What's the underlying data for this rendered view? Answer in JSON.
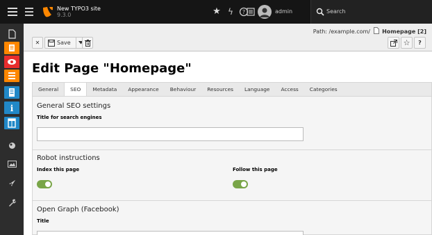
{
  "topbar": {
    "site_name": "New TYPO3 site",
    "version": "9.3.0",
    "username": "admin",
    "search_label": "Search",
    "icons": [
      "menu-icon",
      "module-list-icon",
      "typo3-logo-icon",
      "bookmark-star-icon",
      "flash-icon",
      "help-icon",
      "system-info-icon",
      "user-avatar-icon",
      "search-icon"
    ]
  },
  "sidebar": {
    "items": [
      {
        "name": "page-module-icon",
        "color": "#ff8700"
      },
      {
        "name": "view-module-icon",
        "color": "#e82d2d"
      },
      {
        "name": "list-module-icon",
        "color": "#ff8700"
      },
      {
        "name": "form-module-icon",
        "color": "#2188c7"
      },
      {
        "name": "info-module-icon",
        "color": "#2188c7"
      },
      {
        "name": "template-module-icon",
        "color": "#2188c7"
      },
      {
        "name": "globe-module-icon",
        "color": "#2d2d2d"
      },
      {
        "name": "filelist-module-icon",
        "color": "#2d2d2d"
      },
      {
        "name": "rocket-module-icon",
        "color": "#2d2d2d"
      },
      {
        "name": "tools-module-icon",
        "color": "#2d2d2d"
      }
    ]
  },
  "docheader": {
    "close_label": "✕",
    "save_label": "Save",
    "path_prefix": "Path: /example.com/",
    "path_page": "Homepage [2]"
  },
  "page_title": "Edit Page \"Homepage\"",
  "tabs": [
    {
      "label": "General",
      "active": false
    },
    {
      "label": "SEO",
      "active": true
    },
    {
      "label": "Metadata",
      "active": false
    },
    {
      "label": "Appearance",
      "active": false
    },
    {
      "label": "Behaviour",
      "active": false
    },
    {
      "label": "Resources",
      "active": false
    },
    {
      "label": "Language",
      "active": false
    },
    {
      "label": "Access",
      "active": false
    },
    {
      "label": "Categories",
      "active": false
    }
  ],
  "sections": {
    "general_seo": {
      "title": "General SEO settings",
      "title_field_label": "Title for search engines",
      "title_field_value": ""
    },
    "robots": {
      "title": "Robot instructions",
      "index_label": "Index this page",
      "index_enabled": true,
      "follow_label": "Follow this page",
      "follow_enabled": true
    },
    "open_graph": {
      "title": "Open Graph (Facebook)",
      "og_title_label": "Title",
      "og_title_value": ""
    }
  },
  "colors": {
    "topbar_bg": "#151515",
    "sidebar_bg": "#2d2d2d",
    "toggle_on": "#79a548",
    "typo3_orange": "#ff8700"
  }
}
